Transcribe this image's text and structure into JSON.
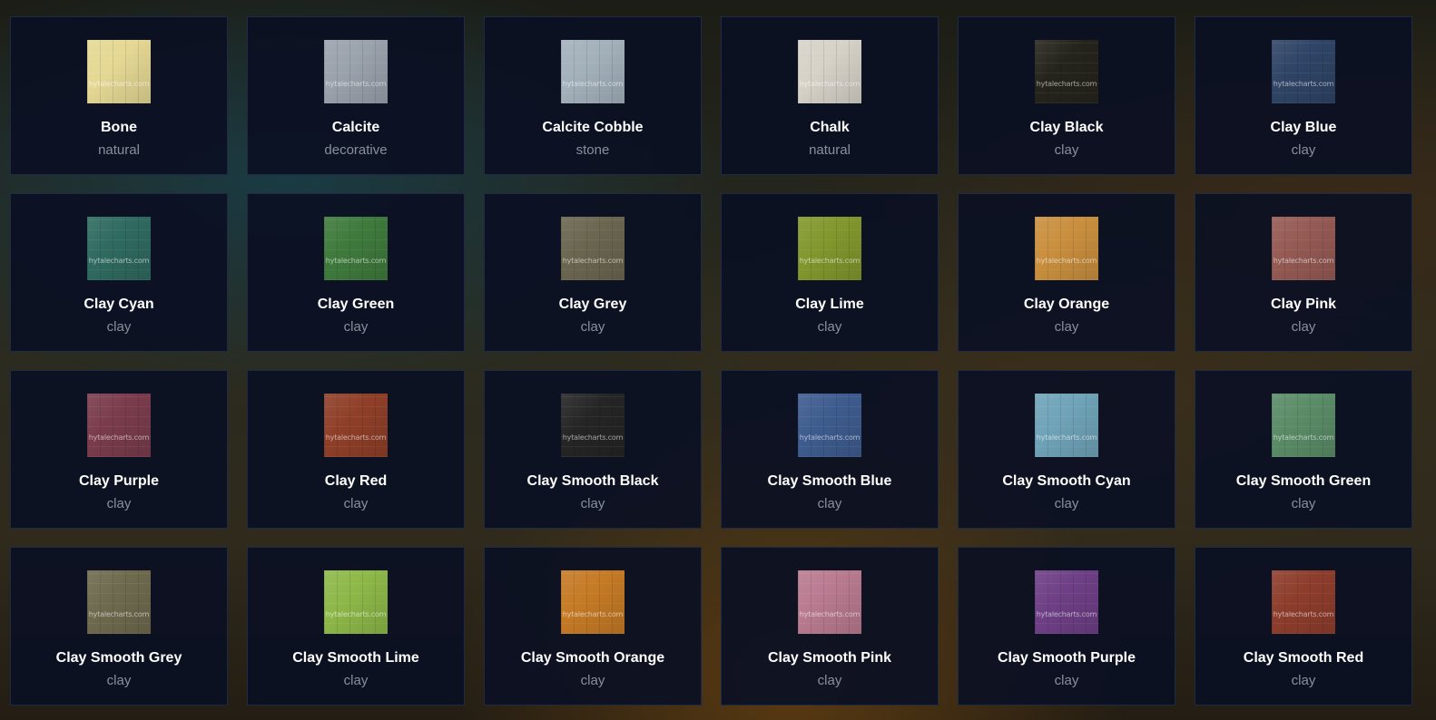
{
  "watermark": "hytalecharts.com",
  "blocks": [
    {
      "name": "Bone",
      "category": "natural",
      "color": "#e5d894"
    },
    {
      "name": "Calcite",
      "category": "decorative",
      "color": "#9aa2ac"
    },
    {
      "name": "Calcite Cobble",
      "category": "stone",
      "color": "#a3b1bb"
    },
    {
      "name": "Chalk",
      "category": "natural",
      "color": "#d6d2c8"
    },
    {
      "name": "Clay Black",
      "category": "clay",
      "color": "#25241c"
    },
    {
      "name": "Clay Blue",
      "category": "clay",
      "color": "#2f4466"
    },
    {
      "name": "Clay Cyan",
      "category": "clay",
      "color": "#2f6a60"
    },
    {
      "name": "Clay Green",
      "category": "clay",
      "color": "#3f7a3c"
    },
    {
      "name": "Clay Grey",
      "category": "clay",
      "color": "#6b6650"
    },
    {
      "name": "Clay Lime",
      "category": "clay",
      "color": "#82972d"
    },
    {
      "name": "Clay Orange",
      "category": "clay",
      "color": "#c98f3e"
    },
    {
      "name": "Clay Pink",
      "category": "clay",
      "color": "#955a54"
    },
    {
      "name": "Clay Purple",
      "category": "clay",
      "color": "#7a3c4c"
    },
    {
      "name": "Clay Red",
      "category": "clay",
      "color": "#8f3f28"
    },
    {
      "name": "Clay Smooth Black",
      "category": "clay",
      "color": "#252525"
    },
    {
      "name": "Clay Smooth Blue",
      "category": "clay",
      "color": "#3e5c8f"
    },
    {
      "name": "Clay Smooth Cyan",
      "category": "clay",
      "color": "#6fa3b8"
    },
    {
      "name": "Clay Smooth Green",
      "category": "clay",
      "color": "#5a8c67"
    },
    {
      "name": "Clay Smooth Grey",
      "category": "clay",
      "color": "#6e6a4e"
    },
    {
      "name": "Clay Smooth Lime",
      "category": "clay",
      "color": "#8db848"
    },
    {
      "name": "Clay Smooth Orange",
      "category": "clay",
      "color": "#c57a25"
    },
    {
      "name": "Clay Smooth Pink",
      "category": "clay",
      "color": "#b97a90"
    },
    {
      "name": "Clay Smooth Purple",
      "category": "clay",
      "color": "#6e3f86"
    },
    {
      "name": "Clay Smooth Red",
      "category": "clay",
      "color": "#8e3d2c"
    }
  ]
}
